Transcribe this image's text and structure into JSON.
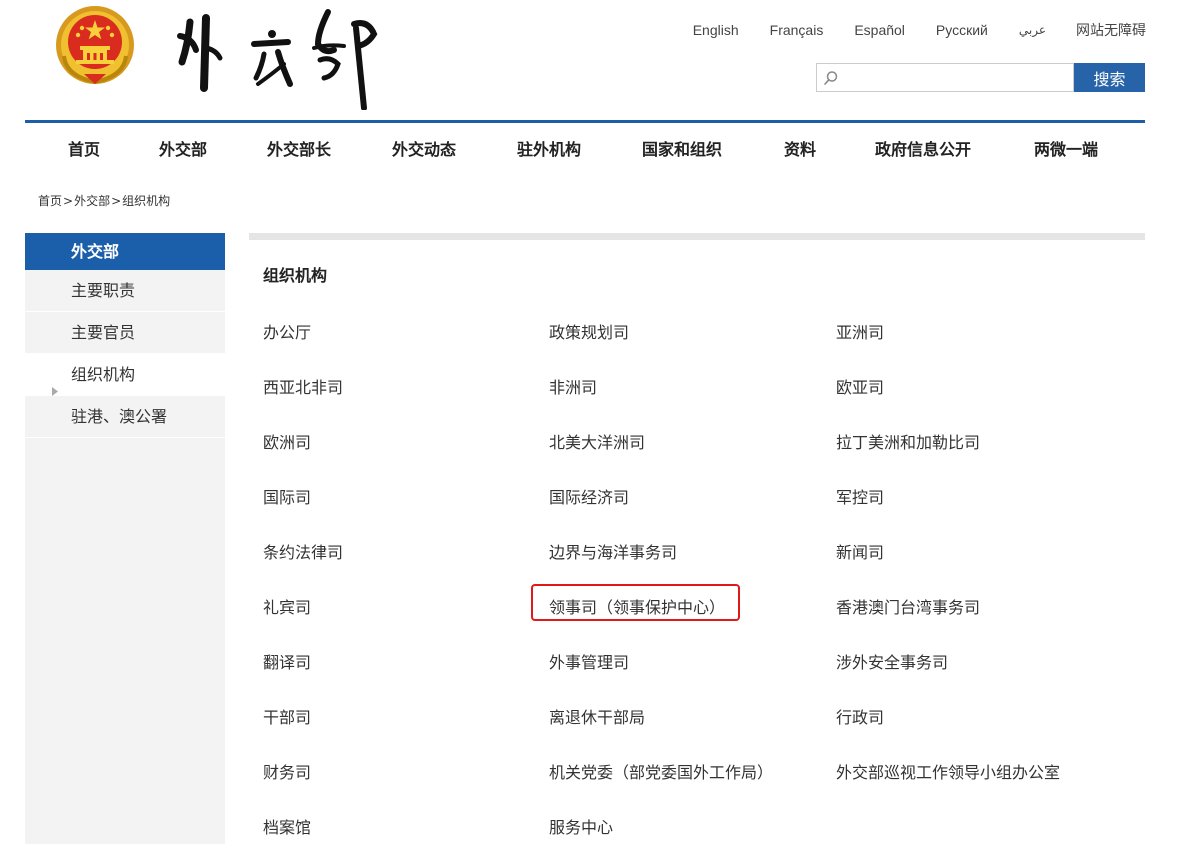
{
  "header": {
    "emblem_icon": "national-emblem-icon",
    "logo_calligraphy": "外交部",
    "languages": [
      "English",
      "Français",
      "Español",
      "Русский",
      "عربي",
      "网站无障碍"
    ],
    "search": {
      "placeholder": "",
      "value": "",
      "button_label": "搜索",
      "icon": "search-icon"
    }
  },
  "nav": {
    "items": [
      "首页",
      "外交部",
      "外交部长",
      "外交动态",
      "驻外机构",
      "国家和组织",
      "资料",
      "政府信息公开",
      "两微一端"
    ]
  },
  "breadcrumb": {
    "items": [
      "首页",
      "外交部",
      "组织机构"
    ],
    "separator": ">"
  },
  "sidebar": {
    "heading": "外交部",
    "items": [
      {
        "label": "主要职责",
        "active": false
      },
      {
        "label": "主要官员",
        "active": false
      },
      {
        "label": "组织机构",
        "active": true
      },
      {
        "label": "驻港、澳公署",
        "active": false
      }
    ]
  },
  "content": {
    "title": "组织机构",
    "departments": [
      [
        "办公厅",
        "政策规划司",
        "亚洲司"
      ],
      [
        "西亚北非司",
        "非洲司",
        "欧亚司"
      ],
      [
        "欧洲司",
        "北美大洋洲司",
        "拉丁美洲和加勒比司"
      ],
      [
        "国际司",
        "国际经济司",
        "军控司"
      ],
      [
        "条约法律司",
        "边界与海洋事务司",
        "新闻司"
      ],
      [
        "礼宾司",
        "领事司（领事保护中心）",
        "香港澳门台湾事务司"
      ],
      [
        "翻译司",
        "外事管理司",
        "涉外安全事务司"
      ],
      [
        "干部司",
        "离退休干部局",
        "行政司"
      ],
      [
        "财务司",
        "机关党委（部党委国外工作局）",
        "外交部巡视工作领导小组办公室"
      ],
      [
        "档案馆",
        "服务中心"
      ]
    ],
    "highlighted": "领事司（领事保护中心）"
  },
  "colors": {
    "primary_blue": "#1b5ea9",
    "search_button": "#2763a8",
    "highlight_red": "#e0191b",
    "sidebar_bg": "#f3f3f3",
    "text": "#333333"
  }
}
